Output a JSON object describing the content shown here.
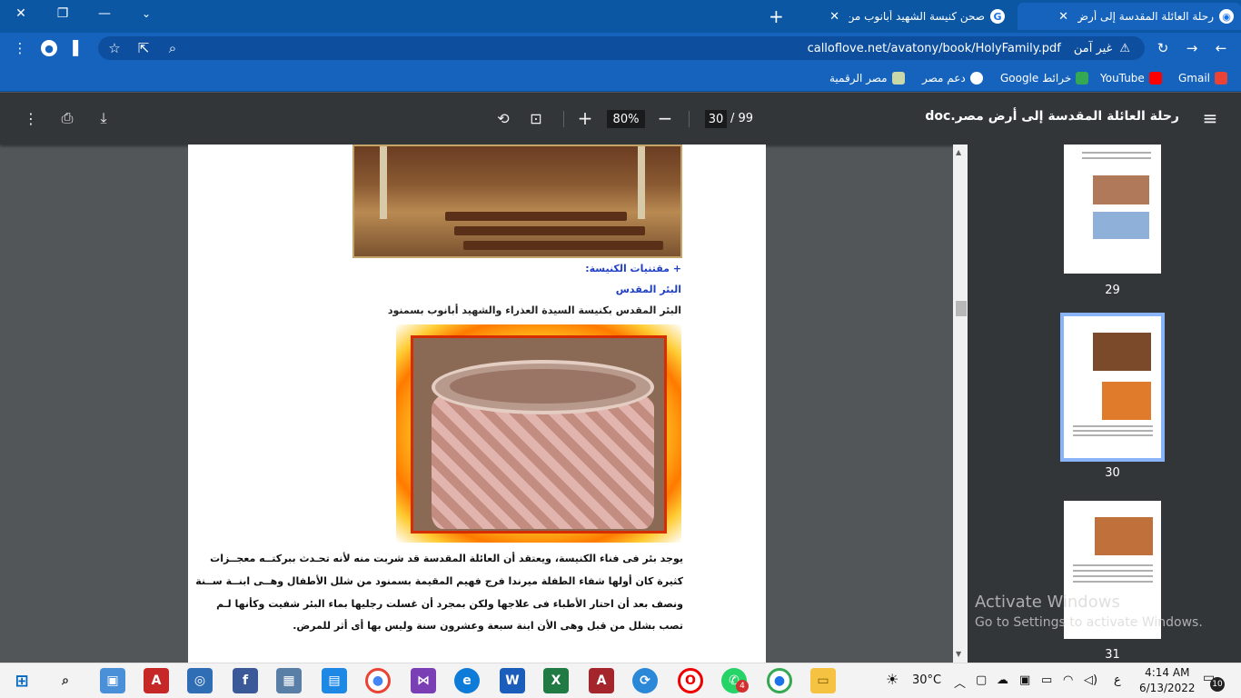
{
  "browser": {
    "tabs": [
      {
        "title": "رحلة العائلة المقدسة إلى أرض مصر",
        "active": true
      },
      {
        "title": "صحن كنيسة الشهيد أبانوب من الداخ",
        "active": false
      }
    ],
    "new_tab_label": "+",
    "address": {
      "security_label": "غير آمن",
      "url": "calloflove.net/avatony/book/HolyFamily.pdf"
    },
    "bookmarks": [
      "Gmail",
      "YouTube",
      "خرائط Google",
      "دعم مصر",
      "مصر الرقمية"
    ]
  },
  "pdf": {
    "title": "رحلة العائلة المقدسة إلى أرض مصر.doc",
    "current_page": "30",
    "total_pages": "/ 99",
    "zoom": "80%"
  },
  "page": {
    "heading1": "+ مقتنيات الكنيسة:",
    "heading2": "البئر المقدس",
    "caption": "البئر المقدس بكنيسة السيدة العذراء والشهيد أبانوب بسمنود",
    "paragraph_lines": [
      "يوجد بئر فى فناء الكنيسة، ويعتقد أن العائلة المقدسة قد شربت منه لأنه تحـدث ببركتــه معجــزات",
      "كثيرة كان أولها شفاء الطفلة ميرندا فرج فهيم المقيمة بسمنود من شلل الأطفال وهــى ابنــة ســنة",
      "ونصف بعد أن احتار الأطباء فى علاجها ولكن بمجرد أن غسلت رجليها بماء البئر شفيت وكأنها لـم",
      "تصب بشلل من قبل وهى الأن ابنة سبعة وعشرون سنة وليس بها أى أثر للمرض."
    ]
  },
  "thumbnails": [
    {
      "label": "29"
    },
    {
      "label": "30"
    },
    {
      "label": "31"
    }
  ],
  "watermark": {
    "line1": "Activate Windows",
    "line2": "Go to Settings to activate Windows."
  },
  "taskbar": {
    "weather": "30°C",
    "lang": "ع",
    "time": "4:14 AM",
    "date": "6/13/2022",
    "notifications": "10",
    "whatsapp_badge": "4"
  }
}
